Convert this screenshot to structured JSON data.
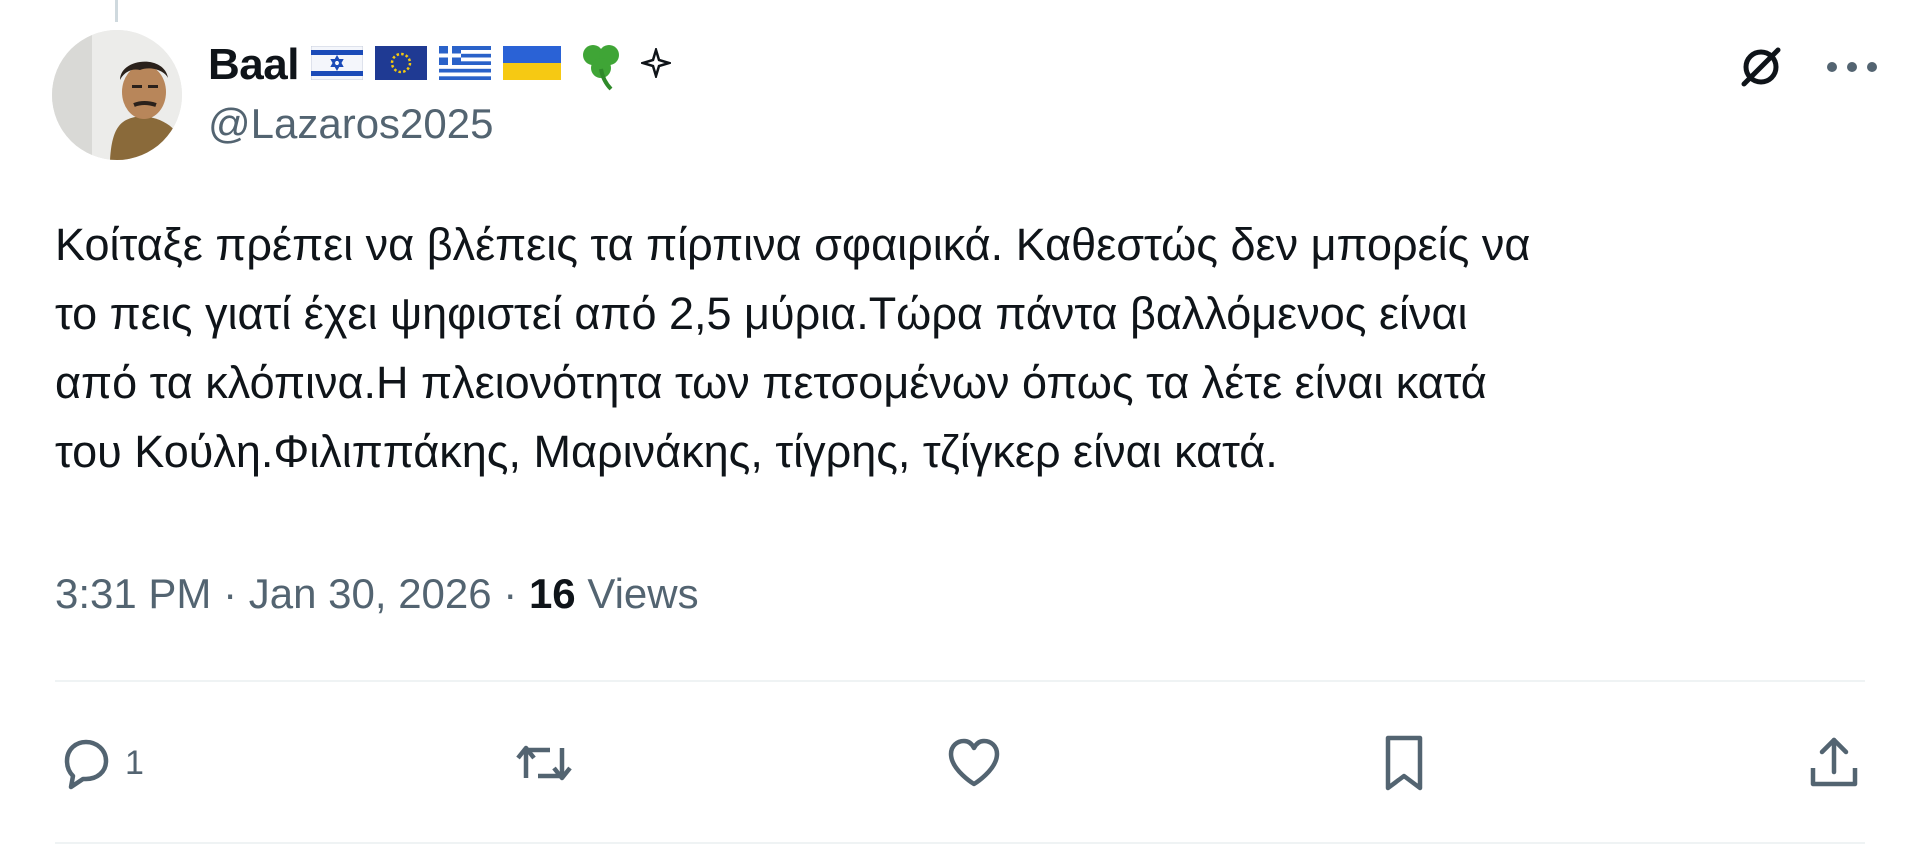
{
  "author": {
    "display_name": "Baal",
    "handle": "@Lazaros2025",
    "badges": [
      "israel-flag-icon",
      "eu-flag-icon",
      "greece-flag-icon",
      "ukraine-flag-icon",
      "shamrock-icon",
      "sparkle-icon"
    ]
  },
  "tweet": {
    "text": "Κοίταξε πρέπει να βλέπεις τα πίρπινα σφαιρικά. Καθεστώς δεν μπορείς να\nτο πεις γιατί έχει ψηφιστεί από 2,5 μύρια.Τώρα πάντα βαλλόμενος είναι\nαπό τα κλόπινα.Η πλειονότητα των πετσομένων όπως τα λέτε είναι κατά\nτου Κούλη.Φιλιππάκης, Μαρινάκης, τίγρης, τζίγκερ είναι κατά.",
    "time": "3:31 PM",
    "date": "Jan 30, 2026",
    "views_count": "16",
    "views_label": "Views"
  },
  "actions": {
    "reply_count": "1"
  },
  "icons": {
    "top": [
      "grok-icon",
      "more-icon"
    ],
    "bottom": [
      "reply-icon",
      "retweet-icon",
      "like-icon",
      "bookmark-icon",
      "share-icon"
    ]
  },
  "colors": {
    "text": "#0f1419",
    "secondary": "#536471",
    "divider": "#eff3f4"
  }
}
